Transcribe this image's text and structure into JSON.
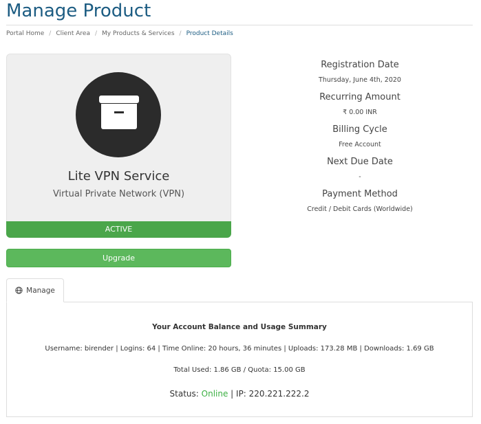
{
  "page": {
    "title": "Manage Product"
  },
  "breadcrumb": [
    "Portal Home",
    "Client Area",
    "My Products & Services",
    "Product Details"
  ],
  "product": {
    "name": "Lite VPN Service",
    "group": "Virtual Private Network (VPN)",
    "status": "ACTIVE",
    "icon": "archive-box-icon",
    "upgrade_label": "Upgrade"
  },
  "details": {
    "registration_label": "Registration Date",
    "registration_value": "Thursday, June 4th, 2020",
    "recurring_label": "Recurring Amount",
    "recurring_value": "₹ 0.00 INR",
    "billing_label": "Billing Cycle",
    "billing_value": "Free Account",
    "due_label": "Next Due Date",
    "due_value": "-",
    "payment_label": "Payment Method",
    "payment_value": "Credit / Debit Cards (Worldwide)"
  },
  "tab": {
    "label": "Manage",
    "icon": "globe-icon"
  },
  "summary": {
    "title": "Your Account Balance and Usage Summary",
    "usage_line": "Username: birender | Logins: 64 | Time Online: 20 hours, 36 minutes | Uploads: 173.28 MB | Downloads: 1.69 GB",
    "total_line": "Total Used: 1.86 GB / Quota: 15.00 GB",
    "status_prefix": "Status: ",
    "status_value": "Online",
    "ip_text": " | IP: 220.221.222.2"
  },
  "colors": {
    "title": "#1c5c82",
    "status_active": "#4aa64a",
    "upgrade": "#5cb85c",
    "online": "#3cb043"
  }
}
